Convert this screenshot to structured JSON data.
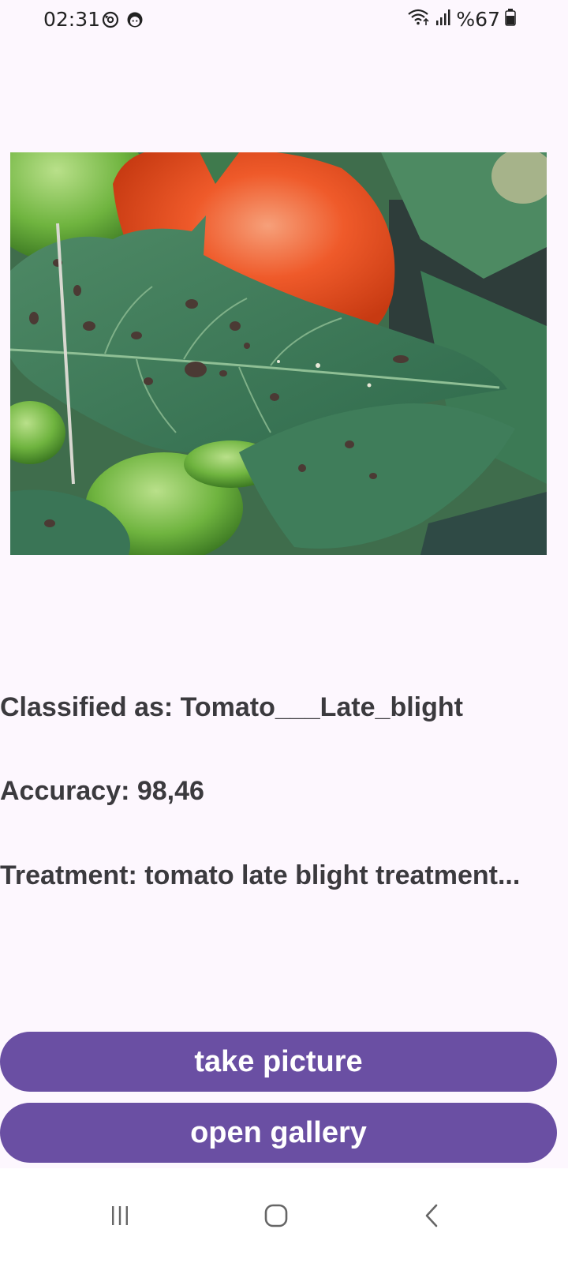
{
  "status_bar": {
    "time": "02:31",
    "notification_icons": [
      "sync-face-icon",
      "avatar-face-icon"
    ],
    "system_icons": [
      "wifi-icon",
      "signal-icon"
    ],
    "battery_text": "%67",
    "battery_icon": "battery-icon"
  },
  "result": {
    "classified": "Classified as: Tomato___Late_blight",
    "accuracy": "Accuracy: 98,46",
    "treatment": "Treatment: tomato late blight treatment..."
  },
  "buttons": {
    "take_picture": "take picture",
    "open_gallery": "open gallery"
  },
  "colors": {
    "background": "#fdf7fe",
    "button": "#6a4fa3",
    "button_text": "#ffffff",
    "text": "#3b3a3e"
  },
  "nav_bar": {
    "icons": [
      "recent-apps-icon",
      "home-icon",
      "back-icon"
    ]
  }
}
